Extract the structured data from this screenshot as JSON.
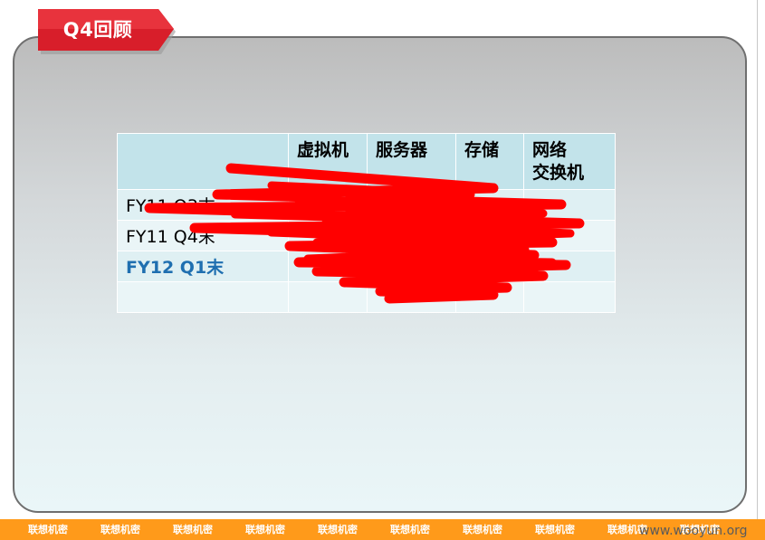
{
  "title": "Q4回顾",
  "table": {
    "headers": [
      "",
      "虚拟机",
      "服务器",
      "存储",
      "网络\n交换机"
    ],
    "rows": [
      {
        "label": "FY11 Q3末"
      },
      {
        "label": "FY11 Q4末"
      },
      {
        "label": "FY12 Q1末"
      },
      {
        "label": ""
      }
    ]
  },
  "footer": {
    "items": [
      "联想机密",
      "联想机密",
      "联想机密",
      "联想机密",
      "联想机密",
      "联想机密",
      "联想机密",
      "联想机密",
      "联想机密",
      "联想机密"
    ]
  },
  "watermark": "www.wooyun.org",
  "colors": {
    "title_tab": "#d81e2a",
    "footer_bar": "#ff9a1a",
    "highlight_row_text": "#1f6fb0",
    "redaction": "#ff0000"
  }
}
